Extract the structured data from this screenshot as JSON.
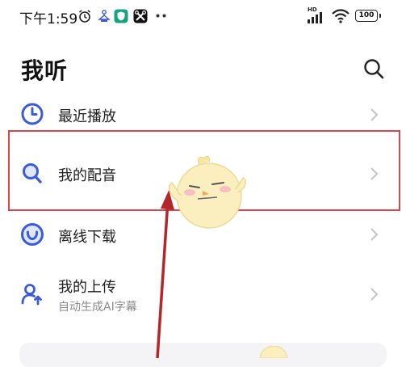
{
  "status_bar": {
    "time": "下午1:59",
    "battery": "100",
    "network_badge": "HD",
    "icons": [
      "alarm-icon",
      "hanger-icon",
      "shield-app-icon",
      "scissors-app-icon",
      "more-dots-icon",
      "signal-icon",
      "wifi-icon",
      "battery-icon"
    ]
  },
  "header": {
    "title": "我听",
    "search_icon": "search-icon"
  },
  "list": {
    "items": [
      {
        "label": "最近播放",
        "subtitle": "",
        "icon": "clock-icon"
      },
      {
        "label": "我的配音",
        "subtitle": "",
        "icon": "search-mic-icon"
      },
      {
        "label": "离线下载",
        "subtitle": "",
        "icon": "download-icon"
      },
      {
        "label": "我的上传",
        "subtitle": "自动生成AI字幕",
        "icon": "upload-user-icon"
      }
    ]
  },
  "colors": {
    "accent": "#3b5bdb",
    "highlight_border": "#d64550",
    "arrow": "#b3262a",
    "chevron": "#c4c4c4",
    "subtitle": "#8a8a8a"
  }
}
